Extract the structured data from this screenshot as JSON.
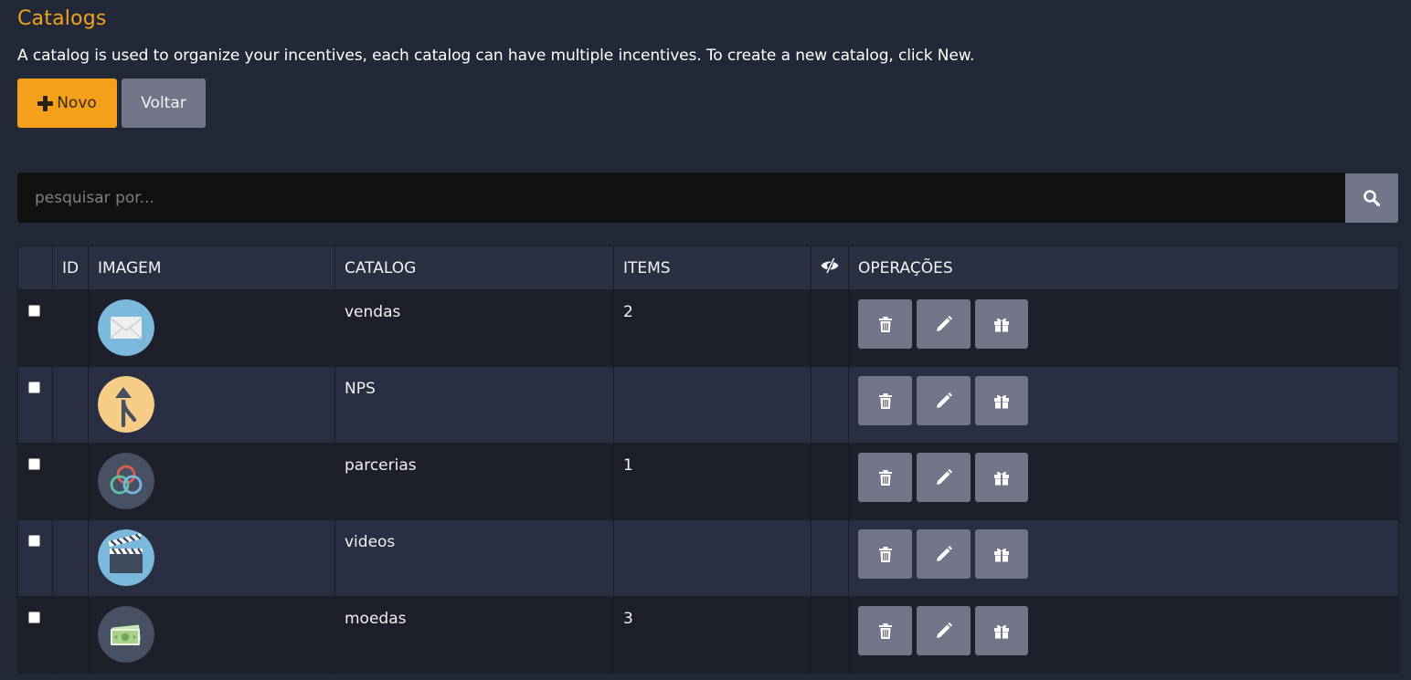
{
  "header": {
    "title": "Catalogs",
    "description": "A catalog is used to organize your incentives, each catalog can have multiple incentives. To create a new catalog, click New."
  },
  "toolbar": {
    "new_label": "Novo",
    "back_label": "Voltar"
  },
  "search": {
    "placeholder": "pesquisar por..."
  },
  "table": {
    "columns": {
      "select": "",
      "id": "ID",
      "image": "IMAGEM",
      "catalog": "CATALOG",
      "items": "ITEMS",
      "visibility": "",
      "operations": "OPERAÇÕES"
    },
    "rows": [
      {
        "id": "",
        "image_icon": "envelope-icon",
        "catalog": "vendas",
        "items": "2"
      },
      {
        "id": "",
        "image_icon": "merge-arrow-icon",
        "catalog": "NPS",
        "items": ""
      },
      {
        "id": "",
        "image_icon": "interlocking-rings-icon",
        "catalog": "parcerias",
        "items": "1"
      },
      {
        "id": "",
        "image_icon": "clapperboard-icon",
        "catalog": "videos",
        "items": ""
      },
      {
        "id": "",
        "image_icon": "banknote-icon",
        "catalog": "moedas",
        "items": "3"
      }
    ],
    "operation_icons": [
      "trash-icon",
      "pencil-icon",
      "gift-icon"
    ]
  },
  "colors": {
    "background": "#232838",
    "accent": "#f4a01b",
    "title": "#f0a21b",
    "button_gray": "#737689",
    "row_dark": "#1d1f2b",
    "row_light": "#2a2e42",
    "header_bg": "#2b2f42",
    "search_bg": "#111112"
  }
}
